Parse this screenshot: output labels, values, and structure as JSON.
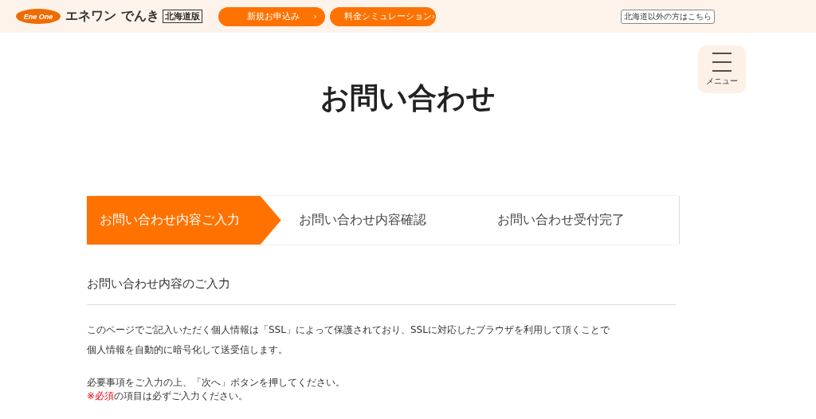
{
  "header": {
    "logo_mark": "Ene One",
    "brand": "エネワン でんき",
    "edition": "北海道版",
    "nav_buttons": [
      {
        "label": "新規お申込み",
        "arrow": "›"
      },
      {
        "label": "料金シミュレーション",
        "arrow": "›"
      }
    ],
    "region_link": "北海道以外の方はこちら"
  },
  "menu_button": {
    "label": "メニュー"
  },
  "page_title": "お問い合わせ",
  "steps": [
    {
      "label": "お問い合わせ内容ご入力",
      "selected": true
    },
    {
      "label": "お問い合わせ内容確認",
      "selected": false
    },
    {
      "label": "お問い合わせ受付完了",
      "selected": false
    }
  ],
  "section_title": "お問い合わせ内容のご入力",
  "intro_lines": [
    "このページでご記入いただく個人情報は「SSL」によって保護されており、SSLに対応したブラウザを利用して頂くことで",
    "個人情報を自動的に暗号化して送受信します。"
  ],
  "instruction": "必要事項をご入力の上、「次へ」ボタンを押してください。",
  "required_note": {
    "marked": "※必須",
    "rest": "の項目は必ずご入力ください。"
  }
}
